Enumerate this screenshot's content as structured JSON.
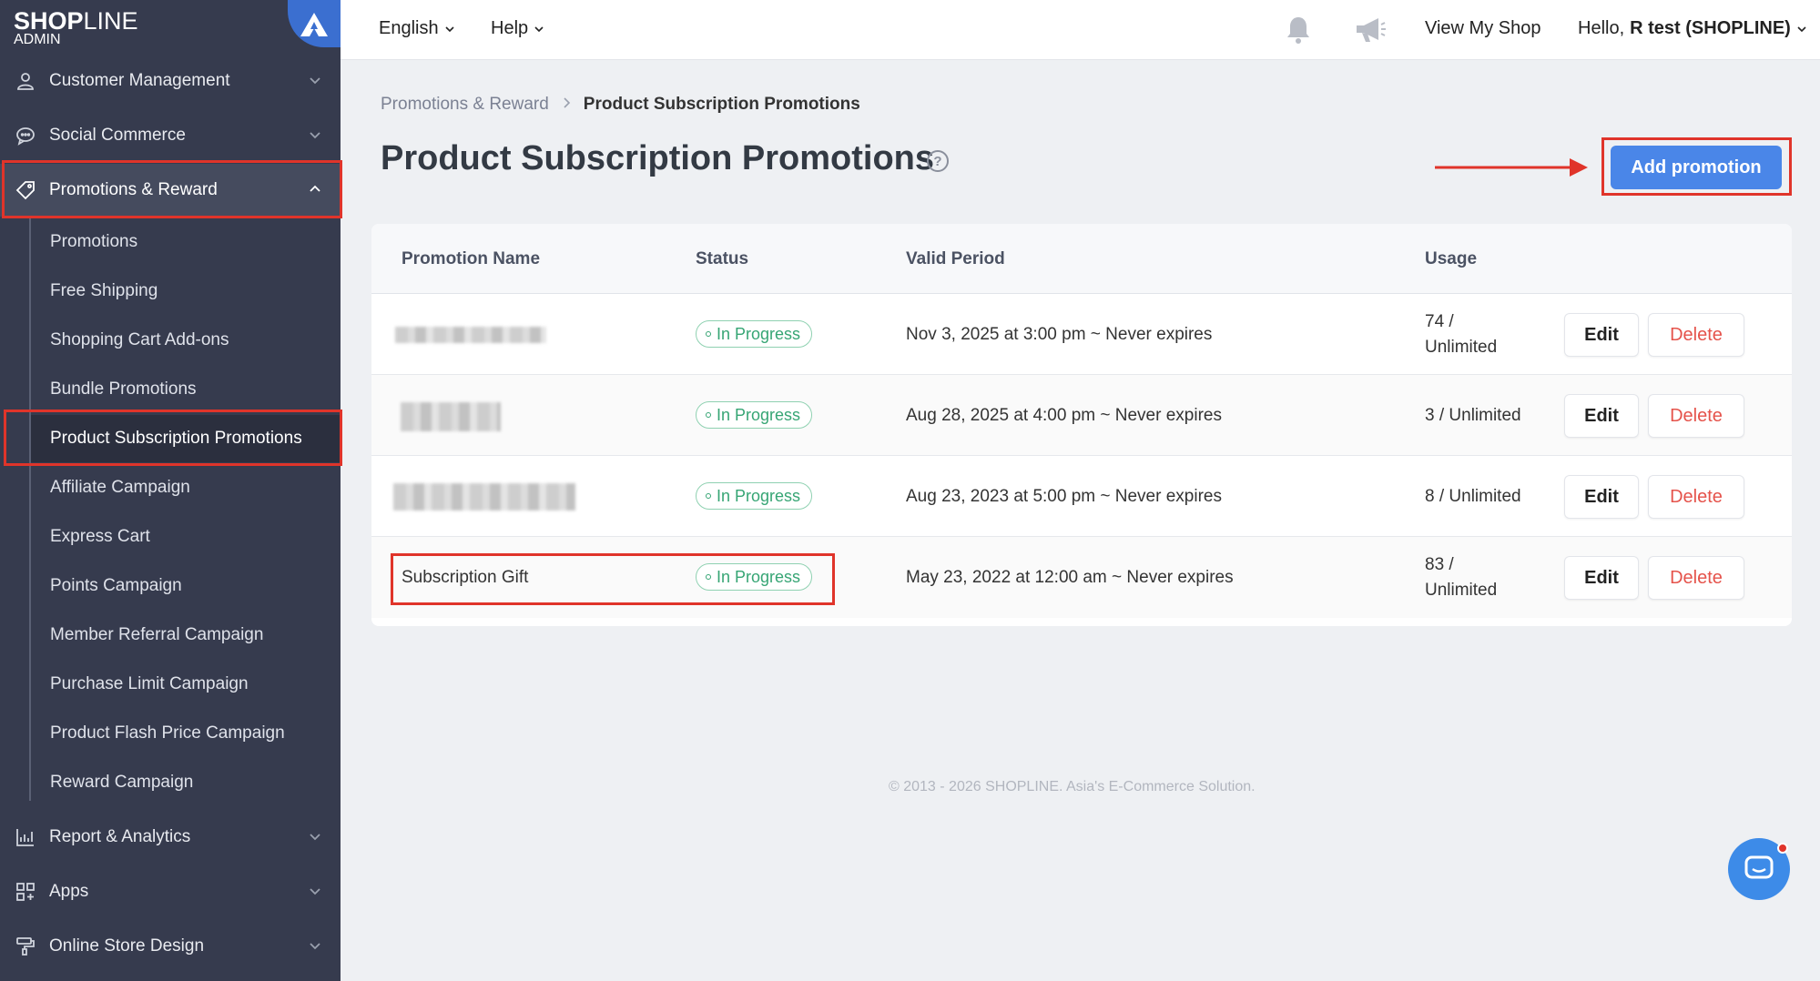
{
  "brand": {
    "logo_main": "SHOP",
    "logo_rest": "LINE",
    "logo_sub": "ADMIN"
  },
  "sidebar": {
    "items": [
      {
        "label": "Customer Management",
        "icon": "user-icon"
      },
      {
        "label": "Social Commerce",
        "icon": "chat-bubble-icon"
      },
      {
        "label": "Promotions & Reward",
        "icon": "tag-icon"
      },
      {
        "label": "Report & Analytics",
        "icon": "chart-icon"
      },
      {
        "label": "Apps",
        "icon": "apps-grid-icon"
      },
      {
        "label": "Online Store Design",
        "icon": "paint-roller-icon"
      }
    ],
    "sub_items": [
      "Promotions",
      "Free Shipping",
      "Shopping Cart Add-ons",
      "Bundle Promotions",
      "Product Subscription Promotions",
      "Affiliate Campaign",
      "Express Cart",
      "Points Campaign",
      "Member Referral Campaign",
      "Purchase Limit Campaign",
      "Product Flash Price Campaign",
      "Reward Campaign"
    ]
  },
  "topbar": {
    "language": "English",
    "help": "Help",
    "view_shop": "View My Shop",
    "greeting": "Hello,",
    "user_name": "R test (SHOPLINE)"
  },
  "breadcrumb": {
    "parent": "Promotions & Reward",
    "current": "Product Subscription Promotions"
  },
  "page": {
    "title": "Product Subscription Promotions",
    "help_glyph": "?",
    "add_button": "Add promotion"
  },
  "table": {
    "headers": {
      "name": "Promotion Name",
      "status": "Status",
      "period": "Valid Period",
      "usage": "Usage"
    },
    "rows": [
      {
        "name": "",
        "status": "In Progress",
        "period": "Nov 3, 2025 at 3:00 pm ~ Never expires",
        "usage_1": "74 /",
        "usage_2": "Unlimited",
        "edit": "Edit",
        "delete": "Delete"
      },
      {
        "name": "",
        "status": "In Progress",
        "period": "Aug 28, 2025 at 4:00 pm ~ Never expires",
        "usage_1": "3 / Unlimited",
        "usage_2": "",
        "edit": "Edit",
        "delete": "Delete"
      },
      {
        "name": "",
        "status": "In Progress",
        "period": "Aug 23, 2023 at 5:00 pm ~ Never expires",
        "usage_1": "8 / Unlimited",
        "usage_2": "",
        "edit": "Edit",
        "delete": "Delete"
      },
      {
        "name": "Subscription Gift",
        "status": "In Progress",
        "period": "May 23, 2022 at 12:00 am ~ Never expires",
        "usage_1": "83 /",
        "usage_2": "Unlimited",
        "edit": "Edit",
        "delete": "Delete"
      }
    ]
  },
  "footer": "© 2013 - 2026 SHOPLINE. Asia's E-Commerce Solution.",
  "colors": {
    "sidebar_bg": "#363b4e",
    "primary": "#4a86e8",
    "success": "#36a574",
    "danger": "#e5534b",
    "highlight": "#e0342a"
  }
}
